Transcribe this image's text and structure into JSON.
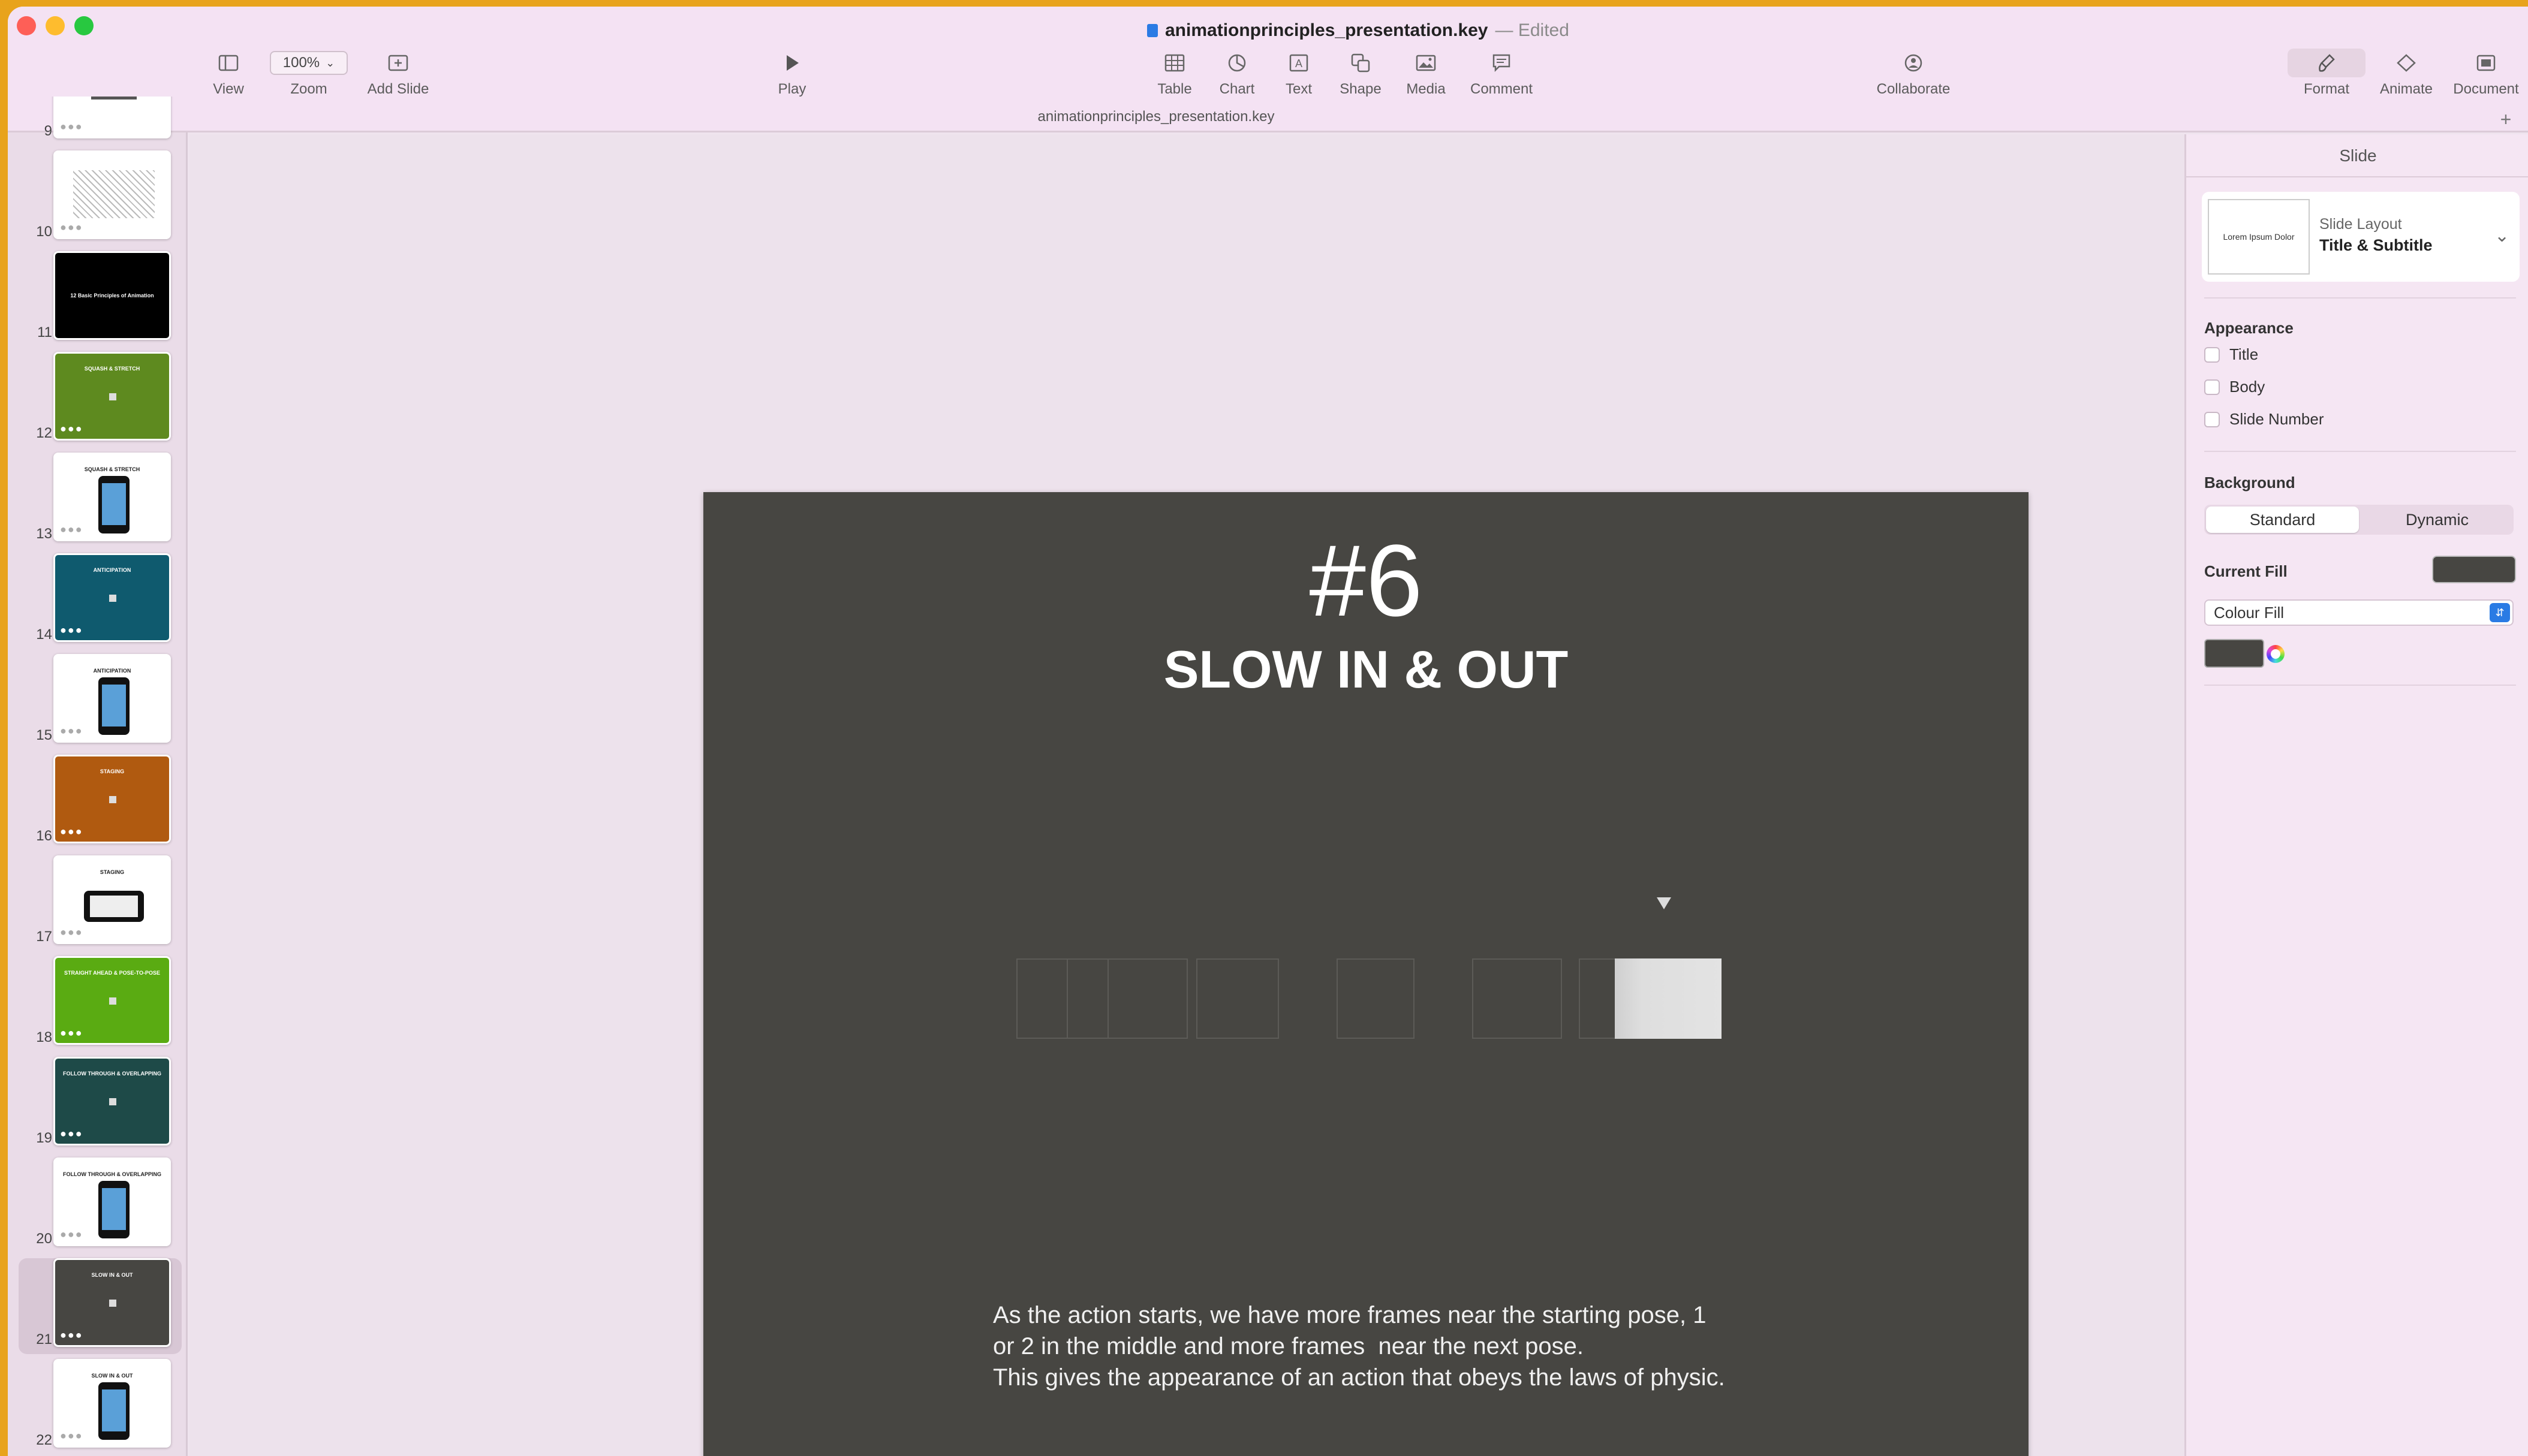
{
  "window": {
    "file_name": "animationprinciples_presentation.key",
    "status": "— Edited"
  },
  "toolbar": {
    "view_label": "View",
    "zoom_value": "100%",
    "zoom_label": "Zoom",
    "add_slide_label": "Add Slide",
    "play_label": "Play",
    "table_label": "Table",
    "chart_label": "Chart",
    "text_label": "Text",
    "shape_label": "Shape",
    "media_label": "Media",
    "comment_label": "Comment",
    "collaborate_label": "Collaborate",
    "format_label": "Format",
    "animate_label": "Animate",
    "document_label": "Document"
  },
  "tab": {
    "name": "animationprinciples_presentation.key",
    "add": "+"
  },
  "navigator": {
    "slides": [
      {
        "num": "9",
        "bg": "#ffffff",
        "kind": "photo",
        "title": ""
      },
      {
        "num": "10",
        "bg": "#ffffff",
        "kind": "sketch",
        "title": ""
      },
      {
        "num": "11",
        "bg": "#000000",
        "kind": "text",
        "title": "12 Basic Principles of Animation"
      },
      {
        "num": "12",
        "bg": "#5e8a1f",
        "kind": "square",
        "title": "SQUASH & STRETCH"
      },
      {
        "num": "13",
        "bg": "#ffffff",
        "kind": "phone",
        "title": "SQUASH & STRETCH"
      },
      {
        "num": "14",
        "bg": "#0f5a6e",
        "kind": "square",
        "title": "ANTICIPATION"
      },
      {
        "num": "15",
        "bg": "#ffffff",
        "kind": "phone",
        "title": "ANTICIPATION"
      },
      {
        "num": "16",
        "bg": "#b05a10",
        "kind": "square",
        "title": "STAGING"
      },
      {
        "num": "17",
        "bg": "#ffffff",
        "kind": "tablet",
        "title": "STAGING"
      },
      {
        "num": "18",
        "bg": "#5aab12",
        "kind": "square",
        "title": "STRAIGHT AHEAD & POSE-TO-POSE"
      },
      {
        "num": "19",
        "bg": "#1e4a48",
        "kind": "square",
        "title": "FOLLOW THROUGH & OVERLAPPING"
      },
      {
        "num": "20",
        "bg": "#ffffff",
        "kind": "phone",
        "title": "FOLLOW THROUGH & OVERLAPPING"
      },
      {
        "num": "21",
        "bg": "#474642",
        "kind": "square",
        "title": "SLOW IN & OUT",
        "selected": true
      },
      {
        "num": "22",
        "bg": "#ffffff",
        "kind": "phone",
        "title": "SLOW IN & OUT"
      }
    ]
  },
  "slide": {
    "number_heading": "#6",
    "title": "SLOW IN & OUT",
    "body_lines": [
      "As the action starts, we have more frames near the starting pose, 1",
      "or 2 in the middle and more frames  near the next pose.",
      "This gives the appearance of an action that obeys the laws of physic."
    ],
    "background_color": "#474642"
  },
  "inspector": {
    "tab_label": "Slide",
    "layout_thumb_text": "Lorem Ipsum Dolor",
    "layout_caption": "Slide Layout",
    "layout_value": "Title & Subtitle",
    "appearance_heading": "Appearance",
    "appearance_options": [
      "Title",
      "Body",
      "Slide Number"
    ],
    "background_heading": "Background",
    "bg_mode_standard": "Standard",
    "bg_mode_dynamic": "Dynamic",
    "current_fill_label": "Current Fill",
    "fill_type": "Colour Fill",
    "fill_color": "#474642"
  }
}
